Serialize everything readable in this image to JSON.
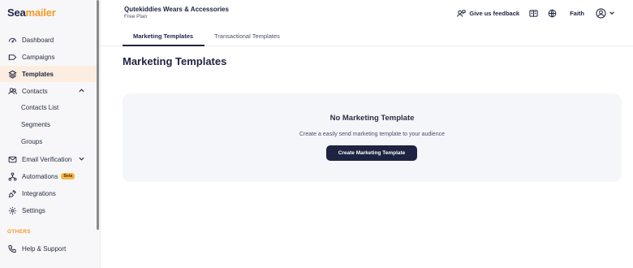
{
  "logo": {
    "part1": "Sea",
    "part2": "mailer"
  },
  "sidebar": {
    "items": [
      {
        "label": "Dashboard",
        "icon": "dashboard-icon"
      },
      {
        "label": "Campaigns",
        "icon": "campaign-icon"
      },
      {
        "label": "Templates",
        "icon": "layers-icon",
        "active": true
      },
      {
        "label": "Contacts",
        "icon": "contacts-icon",
        "expanded": true
      },
      {
        "label": "Email Verification",
        "icon": "mail-check-icon"
      },
      {
        "label": "Automations",
        "icon": "automation-icon",
        "badge": "Beta"
      },
      {
        "label": "Integrations",
        "icon": "plug-icon"
      },
      {
        "label": "Settings",
        "icon": "gear-icon"
      }
    ],
    "contacts_sub": [
      "Contacts List",
      "Segments",
      "Groups"
    ],
    "others_label": "OTHERS",
    "help_label": "Help & Support"
  },
  "header": {
    "org_name": "Qutekiddies Wears & Accessories",
    "plan": "Free Plan",
    "feedback_label": "Give us feedback",
    "user_name": "Faith"
  },
  "tabs": [
    {
      "label": "Marketing Templates",
      "active": true
    },
    {
      "label": "Transactional Templates",
      "active": false
    }
  ],
  "main": {
    "title": "Marketing Templates",
    "empty_title": "No Marketing Template",
    "empty_desc": "Create a easily send marketing template to your audience",
    "create_button": "Create Marketing Template"
  },
  "colors": {
    "brand_dark": "#1d2340",
    "brand_orange": "#f29b2c",
    "active_bg": "#fbeee0"
  }
}
